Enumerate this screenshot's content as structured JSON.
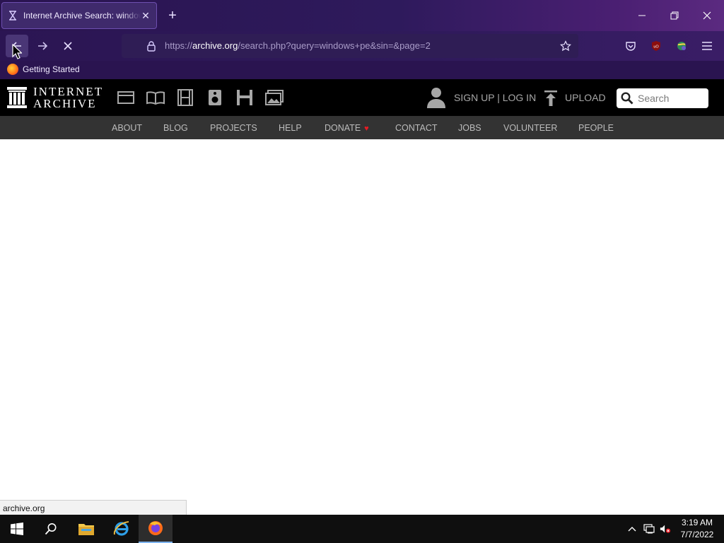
{
  "browser": {
    "tab": {
      "title": "Internet Archive Search: windows+pe",
      "favicon": "archive-favicon"
    },
    "url": {
      "prefix": "https://",
      "host": "archive.org",
      "path": "/search.php?query=windows+pe&sin=&page=2"
    },
    "bookmarks": [
      {
        "label": "Getting Started",
        "icon": "firefox-icon"
      }
    ],
    "status_text": "archive.org"
  },
  "ia": {
    "logo": {
      "line1": "INTERNET",
      "line2": "ARCHIVE"
    },
    "media_icons": [
      "web-icon",
      "texts-icon",
      "video-icon",
      "audio-icon",
      "software-icon",
      "images-icon"
    ],
    "signup": "SIGN UP | LOG IN",
    "upload": "UPLOAD",
    "search_placeholder": "Search",
    "nav": [
      "ABOUT",
      "BLOG",
      "PROJECTS",
      "HELP",
      "DONATE",
      "CONTACT",
      "JOBS",
      "VOLUNTEER",
      "PEOPLE"
    ],
    "donate_icon": "♥",
    "colors": {
      "header": "#000000",
      "nav": "#333333",
      "nav_text": "#bcbcbc",
      "heart": "#e81b23"
    }
  },
  "taskbar": {
    "apps": [
      "windows-start-icon",
      "search-icon",
      "file-explorer-icon",
      "internet-explorer-icon",
      "firefox-icon"
    ],
    "time": "3:19 AM",
    "date": "7/7/2022"
  }
}
